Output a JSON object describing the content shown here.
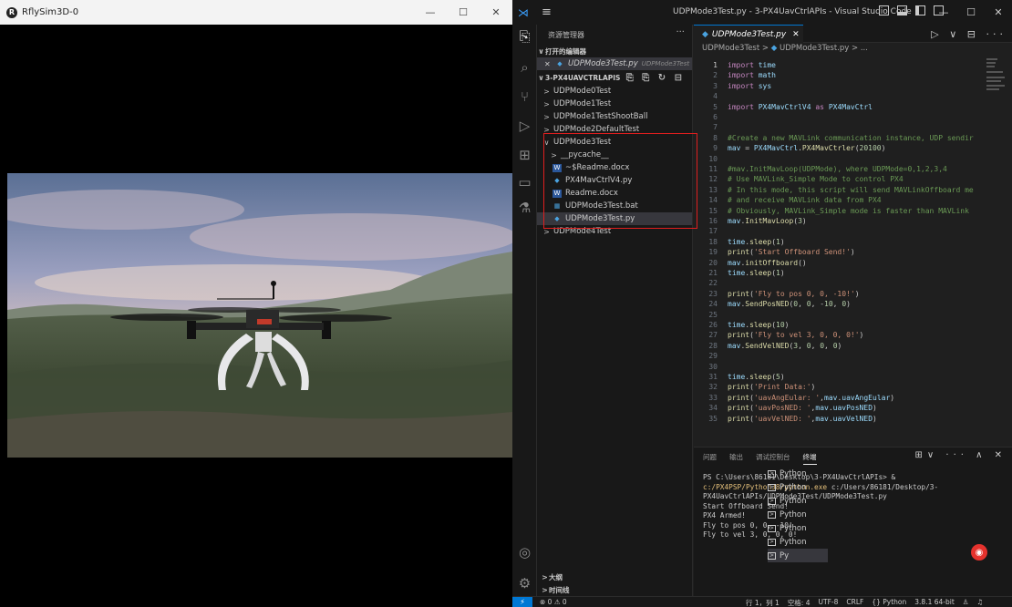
{
  "sim_window": {
    "title": "RflySim3D-0",
    "app_icon": "R",
    "minimize": "—",
    "maximize": "☐",
    "close": "✕"
  },
  "vscode": {
    "title": "UDPMode3Test.py - 3-PX4UavCtrlAPIs - Visual Studio Code",
    "menu_icon": "≡",
    "minimize": "—",
    "maximize": "☐",
    "close": "✕",
    "sidebar": {
      "header": "资源管理器",
      "more": "···",
      "open_editors": "打开的编辑器",
      "open_file_name": "UDPMode3Test.py",
      "open_file_folder": "UDPMode3Test",
      "project": "3-PX4UAVCTRLAPIS",
      "project_tools": "⎘ ⎘ ↻ ⊟",
      "items": [
        {
          "label": "UDPMode0Test",
          "chev": ">",
          "icon": ""
        },
        {
          "label": "UDPMode1Test",
          "chev": ">",
          "icon": ""
        },
        {
          "label": "UDPMode1TestShootBall",
          "chev": ">",
          "icon": ""
        },
        {
          "label": "UDPMode2DefaultTest",
          "chev": ">",
          "icon": ""
        },
        {
          "label": "UDPMode3Test",
          "chev": "∨",
          "icon": ""
        },
        {
          "label": "__pycache__",
          "chev": ">",
          "icon": ""
        },
        {
          "label": "~$Readme.docx",
          "chev": "",
          "icon": "W"
        },
        {
          "label": "PX4MavCtrlV4.py",
          "chev": "",
          "icon": "◆"
        },
        {
          "label": "Readme.docx",
          "chev": "",
          "icon": "W"
        },
        {
          "label": "UDPMode3Test.bat",
          "chev": "",
          "icon": "▦"
        },
        {
          "label": "UDPMode3Test.py",
          "chev": "",
          "icon": "◆"
        },
        {
          "label": "UDPMode4Test",
          "chev": ">",
          "icon": ""
        }
      ],
      "outline": "大纲",
      "timeline": "时间线"
    },
    "tab": {
      "label": "UDPMode3Test.py",
      "close": "✕",
      "actions": "▷ ∨ ⊟ ···"
    },
    "breadcrumb": {
      "folder": "UDPMode3Test",
      "sep": ">",
      "file": "UDPMode3Test.py",
      "tail": "> ..."
    },
    "code_lines": [
      {
        "n": "1",
        "t": "import time"
      },
      {
        "n": "2",
        "t": "import math"
      },
      {
        "n": "3",
        "t": "import sys"
      },
      {
        "n": "4",
        "t": ""
      },
      {
        "n": "5",
        "t": "import PX4MavCtrlV4 as PX4MavCtrl"
      },
      {
        "n": "6",
        "t": ""
      },
      {
        "n": "7",
        "t": ""
      },
      {
        "n": "8",
        "t": "#Create a new MAVLink communication instance, UDP sendir"
      },
      {
        "n": "9",
        "t": "mav = PX4MavCtrl.PX4MavCtrler(20100)"
      },
      {
        "n": "10",
        "t": ""
      },
      {
        "n": "11",
        "t": "#mav.InitMavLoop(UDPMode), where UDPMode=0,1,2,3,4"
      },
      {
        "n": "12",
        "t": "# Use MAVLink_Simple Mode to control PX4"
      },
      {
        "n": "13",
        "t": "# In this mode, this script will send MAVLinkOffboard me"
      },
      {
        "n": "14",
        "t": "# and receive MAVLink data from PX4"
      },
      {
        "n": "15",
        "t": "# Obviously, MAVLink_Simple mode is faster than MAVLink"
      },
      {
        "n": "16",
        "t": "mav.InitMavLoop(3)"
      },
      {
        "n": "17",
        "t": ""
      },
      {
        "n": "18",
        "t": "time.sleep(1)"
      },
      {
        "n": "19",
        "t": "print('Start Offboard Send!')"
      },
      {
        "n": "20",
        "t": "mav.initOffboard()"
      },
      {
        "n": "21",
        "t": "time.sleep(1)"
      },
      {
        "n": "22",
        "t": ""
      },
      {
        "n": "23",
        "t": "print('Fly to pos 0, 0, -10!')"
      },
      {
        "n": "24",
        "t": "mav.SendPosNED(0, 0, -10, 0)"
      },
      {
        "n": "25",
        "t": ""
      },
      {
        "n": "26",
        "t": "time.sleep(10)"
      },
      {
        "n": "27",
        "t": "print('Fly to vel 3, 0, 0, 0!')"
      },
      {
        "n": "28",
        "t": "mav.SendVelNED(3, 0, 0, 0)"
      },
      {
        "n": "29",
        "t": ""
      },
      {
        "n": "30",
        "t": ""
      },
      {
        "n": "31",
        "t": "time.sleep(5)"
      },
      {
        "n": "32",
        "t": "print('Print Data:')"
      },
      {
        "n": "33",
        "t": "print('uavAngEular: ',mav.uavAngEular)"
      },
      {
        "n": "34",
        "t": "print('uavPosNED: ',mav.uavPosNED)"
      },
      {
        "n": "35",
        "t": "print('uavVelNED: ',mav.uavVelNED)"
      }
    ],
    "panel": {
      "tabs": [
        "问题",
        "输出",
        "调试控制台",
        "终端"
      ],
      "actions": "⊞∨ ··· ∧ ✕",
      "terminal_prompt": "PS C:\\Users\\86181\\Desktop\\3-PX4UavCtrlAPIs> & ",
      "terminal_exe": "c:/PX4PSP/Python38/python.exe",
      "terminal_arg": " c:/Users/86181/Desktop/3-PX4UavCtrlAPIs/UDPMode3Test/UDPMode3Test.py",
      "terminal_output": [
        "Start Offboard Send!",
        "PX4 Armed!",
        "Fly to pos 0, 0, -10!",
        "Fly to vel 3, 0, 0, 0!"
      ],
      "terminals": [
        "Python",
        "Python",
        "Python",
        "Python",
        "Python",
        "Python",
        "Py"
      ]
    },
    "statusbar": {
      "remote": "⚡",
      "problems": "⊗ 0 ⚠ 0",
      "position": "行 1，列 1",
      "spaces": "空格: 4",
      "encoding": "UTF-8",
      "eol": "CRLF",
      "language": "{} Python",
      "interpreter": "3.8.1 64-bit"
    }
  }
}
